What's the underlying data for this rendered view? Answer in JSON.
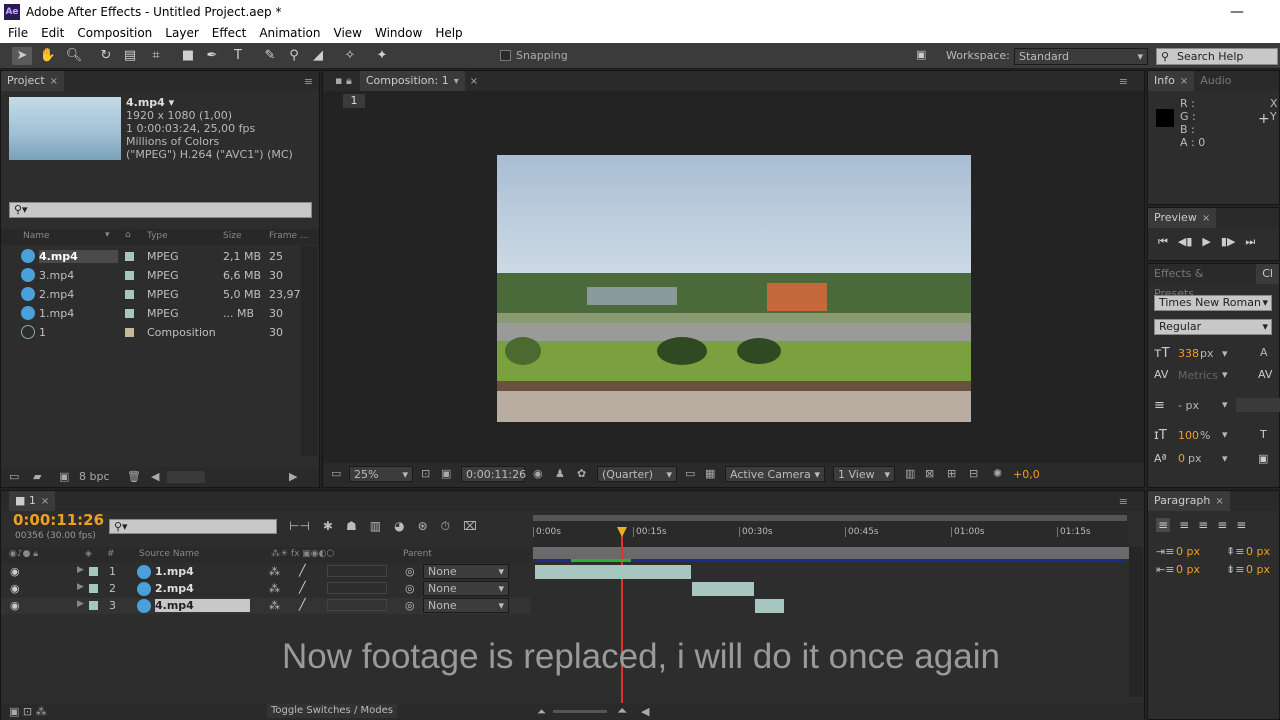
{
  "app": {
    "logo": "Ae",
    "title": "Adobe After Effects - Untitled Project.aep *",
    "menu": [
      "File",
      "Edit",
      "Composition",
      "Layer",
      "Effect",
      "Animation",
      "View",
      "Window",
      "Help"
    ]
  },
  "toolbar": {
    "snapping_label": "Snapping",
    "workspace_label": "Workspace:",
    "workspace_value": "Standard",
    "search_help": "Search Help"
  },
  "project": {
    "tab": "Project",
    "selected_name": "4.mp4 ▾",
    "info_lines": [
      "1920 x 1080 (1,00)",
      "1 0:00:03:24, 25,00 fps",
      "Millions of Colors",
      "(\"MPEG\") H.264 (\"AVC1\") (MC)"
    ],
    "columns": {
      "name": "Name",
      "type": "Type",
      "size": "Size",
      "frame": "Frame ..."
    },
    "items": [
      {
        "name": "4.mp4",
        "type": "MPEG",
        "size": "2,1 MB",
        "frame": "25"
      },
      {
        "name": "3.mp4",
        "type": "MPEG",
        "size": "6,6 MB",
        "frame": "30"
      },
      {
        "name": "2.mp4",
        "type": "MPEG",
        "size": "5,0 MB",
        "frame": "23,976"
      },
      {
        "name": "1.mp4",
        "type": "MPEG",
        "size": "... MB",
        "frame": "30"
      },
      {
        "name": "1",
        "type": "Composition",
        "size": "",
        "frame": "30"
      }
    ],
    "bpc": "8 bpc"
  },
  "composition": {
    "tab": "Composition: 1",
    "sub_tab": "1",
    "zoom": "25%",
    "timecode": "0:00:11:26",
    "resolution": "(Quarter)",
    "camera": "Active Camera",
    "views": "1 View",
    "exposure": "+0,0"
  },
  "info": {
    "tab": "Info",
    "tab2": "Audio",
    "r": "R :",
    "g": "G :",
    "b": "B :",
    "a": "A : 0",
    "x": "X",
    "y": "Y"
  },
  "preview": {
    "tab": "Preview"
  },
  "effects": {
    "tab": "Effects & Presets",
    "tab2": "Cl",
    "font": "Times New Roman",
    "style": "Regular",
    "size": "338",
    "size_unit": "px",
    "metrics": "Metrics",
    "leading_unit": "- px",
    "scale": "100",
    "scale_unit": "%",
    "baseline": "0",
    "baseline_unit": "px"
  },
  "paragraph": {
    "tab": "Paragraph",
    "indent1": "0 px",
    "indent2": "0 px",
    "indent3": "0 px",
    "indent4": "0 px"
  },
  "timeline": {
    "tab": "1",
    "timecode": "0:00:11:26",
    "fps": "00356 (30.00 fps)",
    "col_source": "Source Name",
    "col_parent": "Parent",
    "col_num": "#",
    "layers": [
      {
        "num": "1",
        "name": "1.mp4",
        "parent": "None"
      },
      {
        "num": "2",
        "name": "2.mp4",
        "parent": "None"
      },
      {
        "num": "3",
        "name": "4.mp4",
        "parent": "None"
      }
    ],
    "ruler": [
      "0:00s",
      "00:15s",
      "00:30s",
      "00:45s",
      "01:00s",
      "01:15s"
    ],
    "toggle": "Toggle Switches / Modes",
    "caption": "Now footage is replaced, i will do it once again"
  },
  "colors": {
    "accent": "#f0a020",
    "track": "#a7c6c0",
    "playhead": "#e03030"
  }
}
